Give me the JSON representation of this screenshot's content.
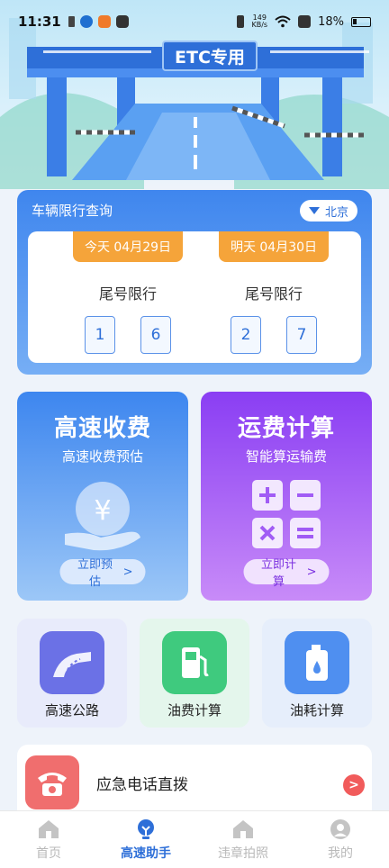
{
  "status_bar": {
    "time": "11:31",
    "net_speed_value": "149",
    "net_speed_unit": "KB/s",
    "battery": "18%"
  },
  "hero": {
    "sign_text": "ETC专用"
  },
  "restriction": {
    "title": "车辆限行查询",
    "city": "北京",
    "days": [
      {
        "date": "今天 04月29日",
        "label": "尾号限行",
        "numbers": [
          "1",
          "6"
        ]
      },
      {
        "date": "明天 04月30日",
        "label": "尾号限行",
        "numbers": [
          "2",
          "7"
        ]
      }
    ]
  },
  "toll_card": {
    "title": "高速收费",
    "subtitle": "高速收费预估",
    "button": "立即预估",
    "icon": "yuan-coin-hand-icon"
  },
  "freight_card": {
    "title": "运费计算",
    "subtitle": "智能算运输费",
    "button": "立即计算",
    "icon": "calculator-icon"
  },
  "tiles": [
    {
      "label": "高速公路",
      "icon": "highway-icon",
      "color": "#6b71e6"
    },
    {
      "label": "油费计算",
      "icon": "fuel-pump-icon",
      "color": "#3fca7e"
    },
    {
      "label": "油耗计算",
      "icon": "oil-can-icon",
      "color": "#4f8ff0"
    }
  ],
  "emergency": {
    "label": "应急电话直拨",
    "icon": "telephone-icon"
  },
  "nav": {
    "items": [
      {
        "label": "首页",
        "icon": "home-icon"
      },
      {
        "label": "高速助手",
        "icon": "bulb-icon"
      },
      {
        "label": "违章拍照",
        "icon": "home-icon"
      },
      {
        "label": "我的",
        "icon": "user-icon"
      }
    ],
    "active": "高速助手"
  },
  "colors": {
    "primary": "#2e6fd8",
    "orange": "#f5a43a",
    "purple": "#8a3ef3",
    "red_highlight": "#e21e1e"
  }
}
